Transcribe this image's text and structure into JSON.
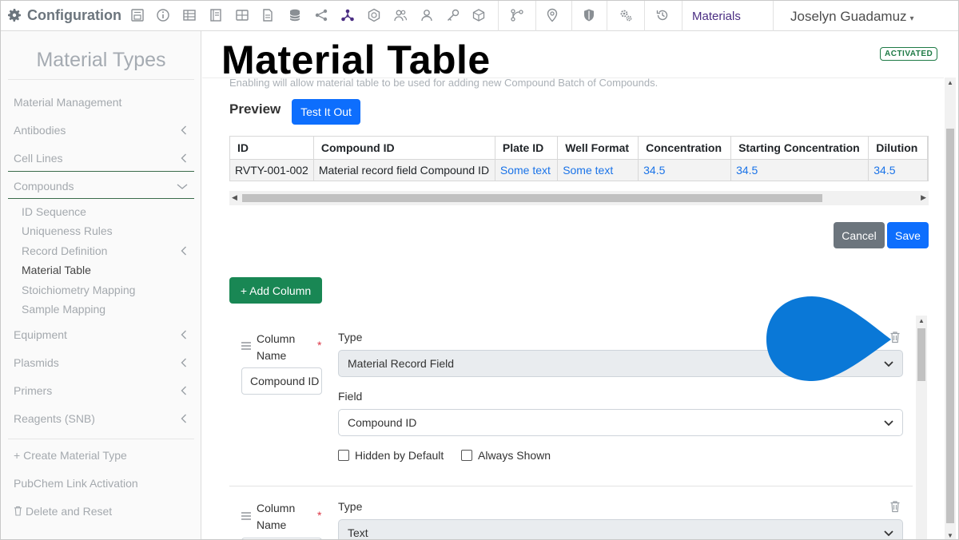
{
  "nav": {
    "brand": "Configuration",
    "icons": [
      "form-icon",
      "info-icon",
      "table-icon",
      "notebook-icon",
      "grid-icon",
      "document-icon",
      "database-icon",
      "share-icon",
      "molecule-icon",
      "badge-icon",
      "user-group-icon",
      "user-icon",
      "key-icon",
      "cube-icon",
      "workflow-icon",
      "location-pin-icon",
      "shield-icon",
      "gears-icon",
      "history-icon"
    ],
    "materials_link": "Materials",
    "user_name": "Joselyn Guadamuz",
    "accent": "#4b2e83"
  },
  "sidebar": {
    "title": "Material Types",
    "items": [
      {
        "label": "Material Management"
      },
      {
        "label": "Antibodies"
      },
      {
        "label": "Cell Lines"
      },
      {
        "label": "Compounds"
      }
    ],
    "compound_subitems": [
      {
        "label": "ID Sequence"
      },
      {
        "label": "Uniqueness Rules"
      },
      {
        "label": "Record Definition"
      },
      {
        "label": "Material Table"
      },
      {
        "label": "Stoichiometry Mapping"
      },
      {
        "label": "Sample Mapping"
      }
    ],
    "more_items": [
      {
        "label": "Equipment"
      },
      {
        "label": "Plasmids"
      },
      {
        "label": "Primers"
      },
      {
        "label": "Reagents (SNB)"
      }
    ],
    "create_label": "Create Material Type",
    "pubchem_label": "PubChem Link Activation",
    "delete_label": "Delete and Reset"
  },
  "main": {
    "title": "Material Table",
    "status_badge": "ACTIVATED",
    "hint": "Enabling will allow material table to be used for adding new Compound Batch of Compounds.",
    "preview_label": "Preview",
    "test_button": "Test It Out",
    "preview_table": {
      "headers": [
        "ID",
        "Compound ID",
        "Plate ID",
        "Well Format",
        "Concentration",
        "Starting Concentration",
        "Dilution"
      ],
      "row": [
        "RVTY-001-002",
        "Material record field Compound ID",
        "Some text",
        "Some text",
        "34.5",
        "34.5",
        "34.5"
      ]
    },
    "cancel_button": "Cancel",
    "save_button": "Save",
    "add_column_button": "+ Add Column",
    "columns": [
      {
        "column_name_label": "Column Name",
        "column_name_value": "Compound ID",
        "type_label": "Type",
        "type_value": "Material Record Field",
        "field_label": "Field",
        "field_value": "Compound ID",
        "hidden_label": "Hidden by Default",
        "always_label": "Always Shown"
      },
      {
        "column_name_label": "Column Name",
        "type_label": "Type",
        "type_value": "Text"
      }
    ]
  },
  "colors": {
    "primary": "#0d6efd",
    "success": "#198754",
    "secondary": "#6c757d",
    "pointer": "#0a78d7"
  }
}
